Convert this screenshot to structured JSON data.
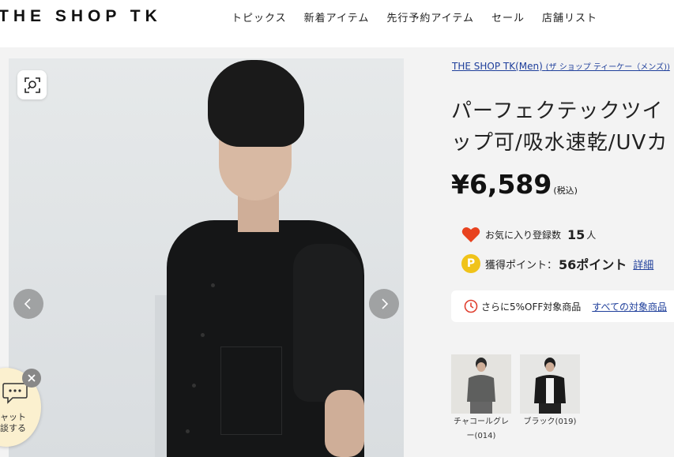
{
  "header": {
    "logo": "THE SHOP TK",
    "nav": [
      "トピックス",
      "新着アイテム",
      "先行予約アイテム",
      "セール",
      "店舗リスト"
    ]
  },
  "product": {
    "brand": "THE SHOP TK(Men)",
    "brand_kana": "(ザ ショップ ティーケー（メンズ))",
    "title_line1": "パーフェクテックツイ",
    "title_line2": "ップ可/吸水速乾/UVカ",
    "price": "¥6,589",
    "tax_note": "(税込)",
    "favorite_label": "お気に入り登録数",
    "favorite_count": "15",
    "favorite_unit": "人",
    "points_label": "獲得ポイント：",
    "points_value": "56ポイント",
    "points_detail_link": "詳細",
    "offer_text": "さらに5%OFF対象商品",
    "offer_link": "すべての対象商品",
    "swatches": [
      {
        "label": "チャコールグレー(014)"
      },
      {
        "label": "ブラック(019)"
      }
    ]
  },
  "chat": {
    "line1": "ャット",
    "line2": "談する"
  },
  "colors": {
    "link": "#1f3f9b",
    "heart": "#e8421f",
    "point": "#f0c31a",
    "offer_icon": "#e04030"
  }
}
